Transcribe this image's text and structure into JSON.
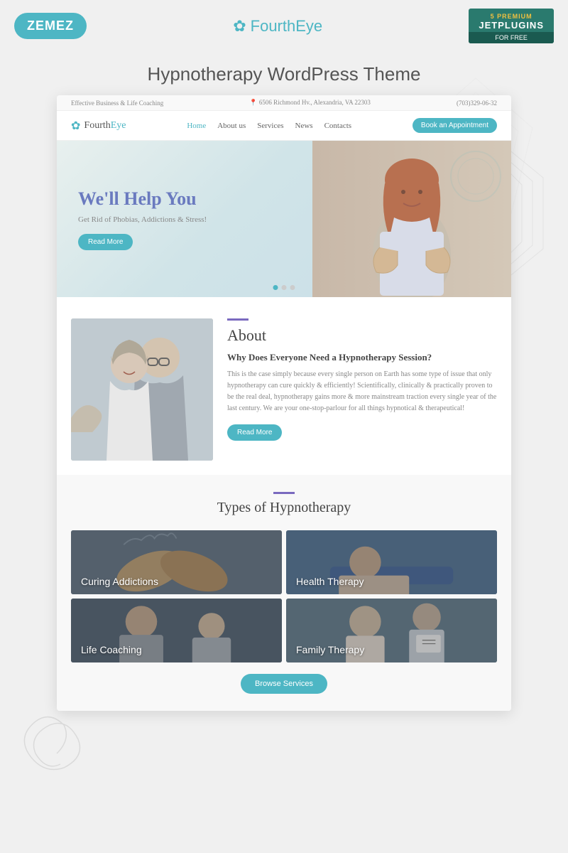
{
  "topbar": {
    "zemez_label": "ZEMEZ",
    "brand_name_first": "Fourth",
    "brand_name_second": "Eye",
    "badge_premium": "5 PREMIUM",
    "badge_main": "JETPLUGINS",
    "badge_sub": "FOR FREE"
  },
  "page_title": "Hypnotherapy WordPress Theme",
  "site": {
    "topbar_left": "Effective Business & Life Coaching",
    "topbar_location": "6506 Richmond Hv., Alexandria, VA 22303",
    "topbar_phone": "(703)329-06-32",
    "logo_text_first": "Fourth",
    "logo_text_second": "Eye",
    "nav": {
      "home": "Home",
      "about": "About us",
      "services": "Services",
      "news": "News",
      "contacts": "Contacts"
    },
    "cta_button": "Book an Appointment",
    "hero": {
      "heading": "We'll Help You",
      "subheading": "Get Rid of Phobias, Addictions & Stress!",
      "read_more": "Read More"
    },
    "about": {
      "divider": "",
      "title": "About",
      "question": "Why Does Everyone Need a Hypnotherapy Session?",
      "body": "This is the case simply because every single person on Earth has some type of issue that only hypnotherapy can cure quickly & efficiently! Scientifically, clinically & practically proven to be the real deal, hypnotherapy gains more & more mainstream traction every single year of the last century. We are your one-stop-parlour for all things hypnotical & therapeutical!",
      "read_more": "Read More"
    },
    "types": {
      "divider": "",
      "title": "Types of Hypnotherapy",
      "cards": [
        {
          "label": "Curing Addictions",
          "id": "curing-addictions"
        },
        {
          "label": "Health Therapy",
          "id": "health-therapy"
        },
        {
          "label": "Life Coaching",
          "id": "life-coaching"
        },
        {
          "label": "Family Therapy",
          "id": "family-therapy"
        }
      ],
      "browse_btn": "Browse Services"
    }
  }
}
